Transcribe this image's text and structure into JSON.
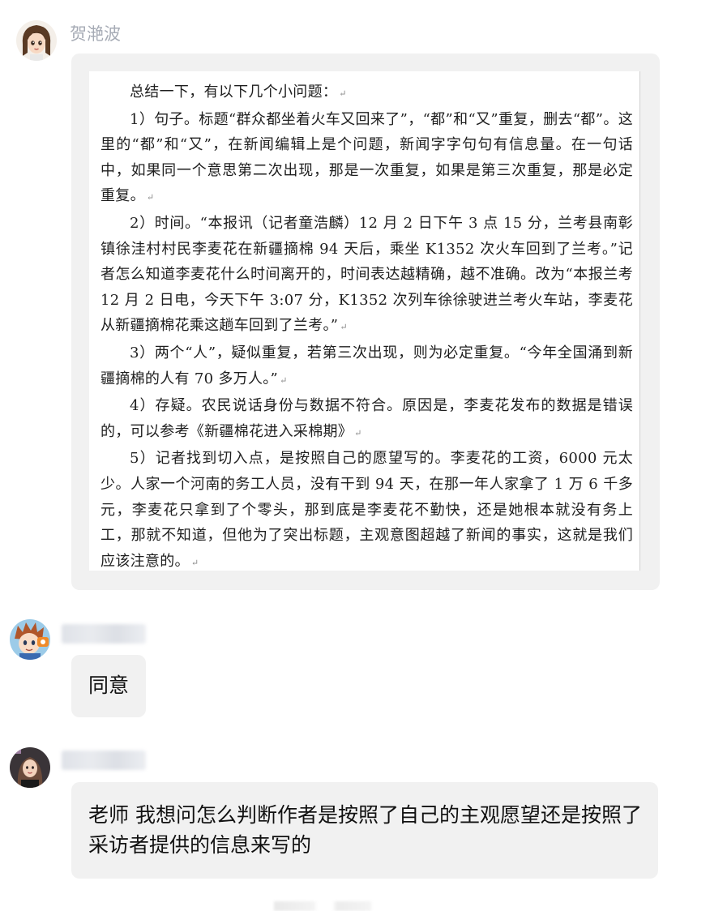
{
  "messages": [
    {
      "sender": "贺滟波",
      "avatar_icon": "cartoon-girl-avatar",
      "type": "image",
      "document": {
        "paragraphs": [
          "总结一下，有以下几个小问题：",
          "1）句子。标题“群众都坐着火车又回来了”，“都”和“又”重复，删去“都”。这里的“都”和“又”，在新闻编辑上是个问题，新闻字字句句有信息量。在一句话中，如果同一个意思第二次出现，那是一次重复，如果是第三次重复，那是必定重复。",
          "2）时间。“本报讯（记者童浩麟）12 月 2 日下午 3 点 15 分，兰考县南彰镇徐洼村村民李麦花在新疆摘棉 94 天后，乘坐 K1352 次火车回到了兰考。”记者怎么知道李麦花什么时间离开的，时间表达越精确，越不准确。改为“本报兰考 12 月 2 日电，今天下午 3:07 分，K1352 次列车徐徐驶进兰考火车站，李麦花从新疆摘棉花乘这趟车回到了兰考。”",
          "3）两个“人”，疑似重复，若第三次出现，则为必定重复。“今年全国涌到新疆摘棉的人有 70 多万人。”",
          "4）存疑。农民说话身份与数据不符合。原因是，李麦花发布的数据是错误的，可以参考《新疆棉花进入采棉期》",
          "5）记者找到切入点，是按照自己的愿望写的。李麦花的工资，6000 元太少。人家一个河南的务工人员，没有干到 94 天，在那一年人家拿了 1 万 6 千多元，李麦花只拿到了个零头，那到底是李麦花不勤快，还是她根本就没有务上工，那就不知道，但他为了突出标题，主观意图超越了新闻的事实，这就是我们应该注意的。"
        ],
        "paragraph_mark": "↵"
      }
    },
    {
      "sender": "",
      "avatar_icon": "cartoon-boy-avatar",
      "type": "text",
      "text": "同意"
    },
    {
      "sender": "",
      "avatar_icon": "woman-photo-avatar",
      "type": "text",
      "text": "老师 我想问怎么判断作者是按照了自己的主观愿望还是按照了采访者提供的信息来写的"
    }
  ],
  "colors": {
    "bubble_bg": "#f1f1f1",
    "sender_name": "#a6abb5",
    "message_text": "#111111",
    "page_bg": "#ffffff"
  }
}
